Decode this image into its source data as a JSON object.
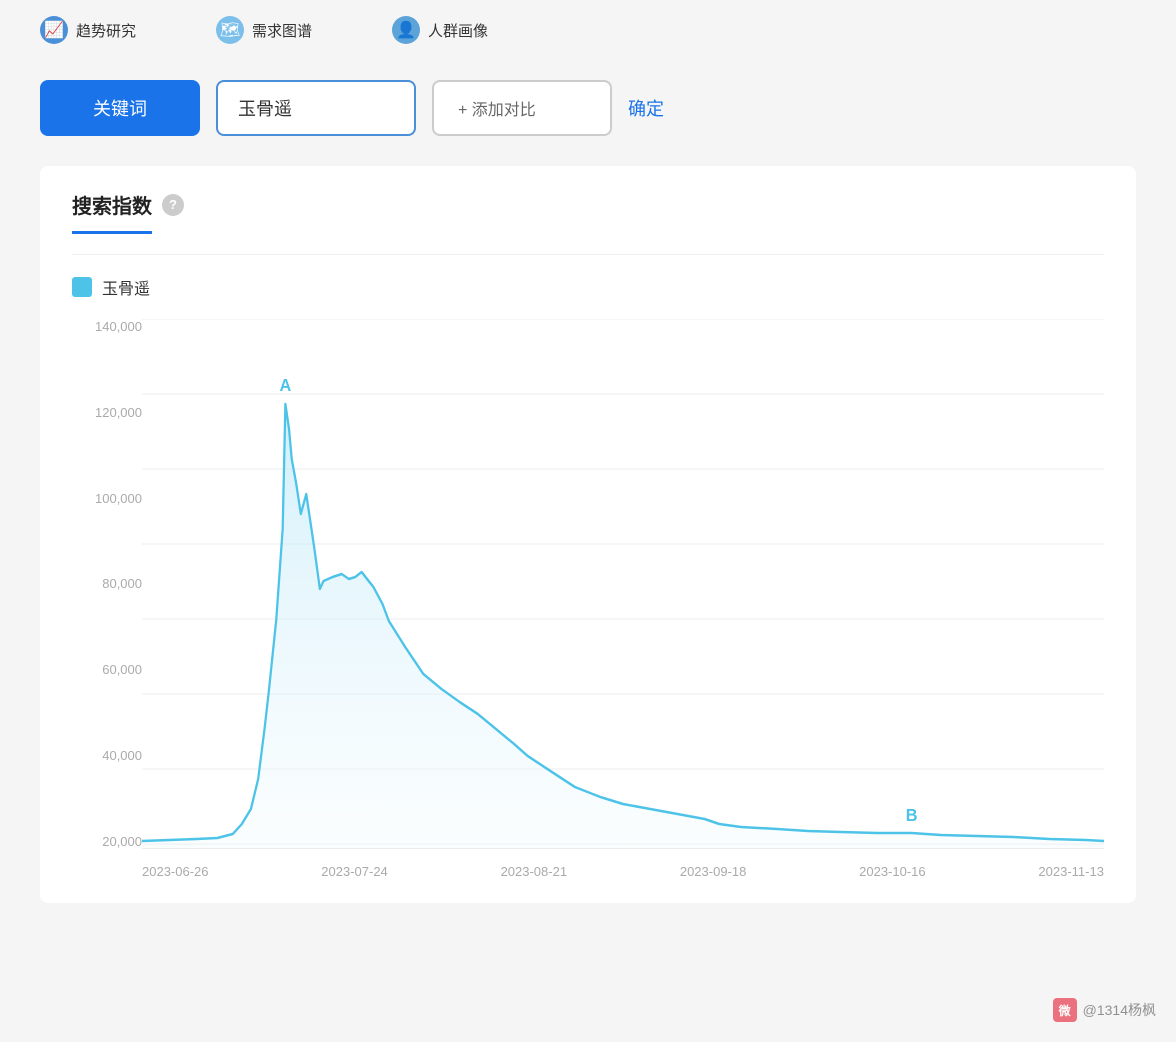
{
  "nav": {
    "items": [
      {
        "label": "趋势研究",
        "icon": "📈",
        "iconType": "blue"
      },
      {
        "label": "需求图谱",
        "icon": "🗺",
        "iconType": "lightblue"
      },
      {
        "label": "人群画像",
        "icon": "👤",
        "iconType": "person"
      }
    ]
  },
  "searchBar": {
    "keywordBtn": "关键词",
    "inputValue": "玉骨遥",
    "addCompareBtn": "+ 添加对比",
    "confirmBtn": "确定"
  },
  "section": {
    "title": "搜索指数",
    "helpIcon": "?",
    "legendLabel": "玉骨遥"
  },
  "chart": {
    "yLabels": [
      "140,000",
      "120,000",
      "100,000",
      "80,000",
      "60,000",
      "40,000",
      "20,000"
    ],
    "xLabels": [
      "2023-06-26",
      "2023-07-24",
      "2023-08-21",
      "2023-09-18",
      "2023-10-16",
      "2023-11-13"
    ],
    "pointA": "A",
    "pointB": "B",
    "accentColor": "#4dc3e8",
    "fillColor": "#d6f0fb"
  },
  "watermark": {
    "text": "@1314杨枫",
    "platform": "微博"
  }
}
